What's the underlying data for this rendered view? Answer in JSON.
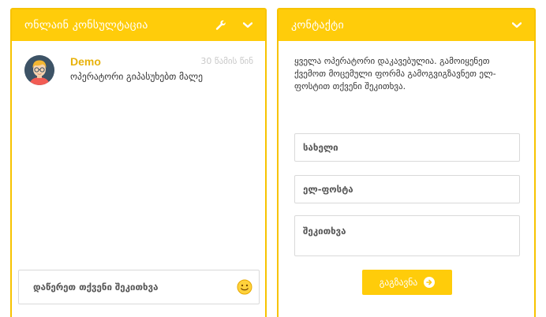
{
  "chat": {
    "title": "ონლაინ კონსულტაცია",
    "icons": {
      "settings": "wrench-icon",
      "collapse": "chevron-down-icon"
    },
    "message": {
      "author": "Demo",
      "time": "30 წამის წინ",
      "text": "ოპერატორი გიპასუხებთ მალე",
      "avatar": "operator-avatar"
    },
    "input_placeholder": "დაწერეთ თქვენი შეკითხვა",
    "emoji_icon": "smiley-icon"
  },
  "contact": {
    "title": "კონტაქტი",
    "collapse_icon": "chevron-down-icon",
    "intro": "ყველა ოპერატორი დაკავებულია. გამოიყენეთ ქვემოთ მოცემული ფორმა გამოგვიგზავნეთ ელ-ფოსტით თქვენი შეკითხვა.",
    "name_placeholder": "სახელი",
    "email_placeholder": "ელ-ფოსტა",
    "question_placeholder": "შეკითხვა",
    "send_label": "გაგზავნა",
    "send_icon": "arrow-right-circle-icon"
  },
  "colors": {
    "accent": "#ffcc0a",
    "author": "#e8b20b",
    "border": "#d9d9d9"
  }
}
